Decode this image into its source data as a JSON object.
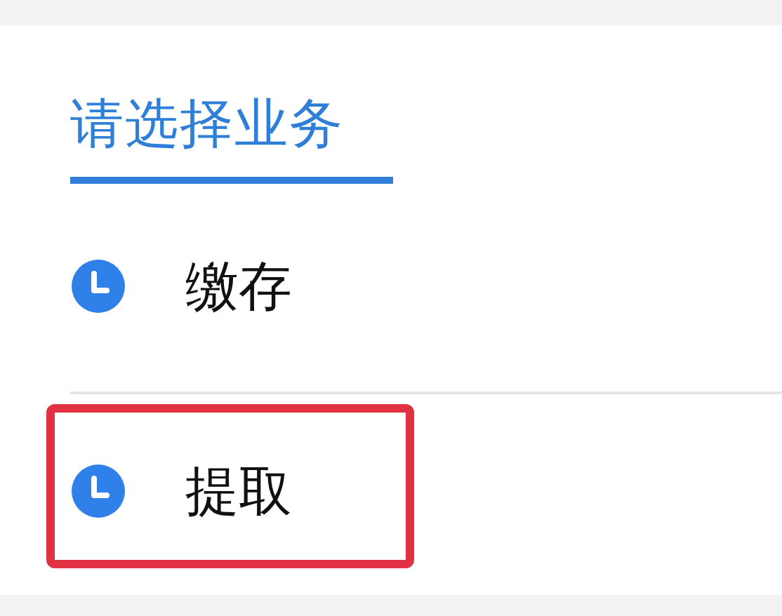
{
  "title": "请选择业务",
  "items": [
    {
      "label": "缴存",
      "highlighted": false
    },
    {
      "label": "提取",
      "highlighted": true
    }
  ]
}
